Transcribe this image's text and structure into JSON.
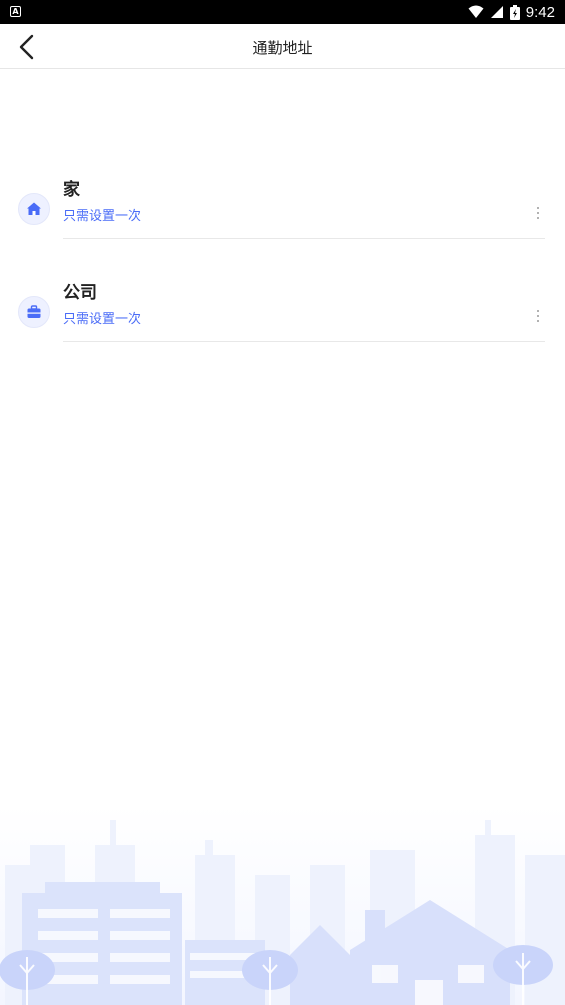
{
  "status_bar": {
    "time": "9:42",
    "left_icon_letter": "A"
  },
  "header": {
    "title": "通勤地址"
  },
  "addresses": [
    {
      "name": "家",
      "subtitle": "只需设置一次",
      "icon": "home-icon"
    },
    {
      "name": "公司",
      "subtitle": "只需设置一次",
      "icon": "briefcase-icon"
    }
  ],
  "colors": {
    "accent": "#4a6cf7",
    "icon_bg": "#eef1ff",
    "skyline": "#dbe3fb"
  }
}
